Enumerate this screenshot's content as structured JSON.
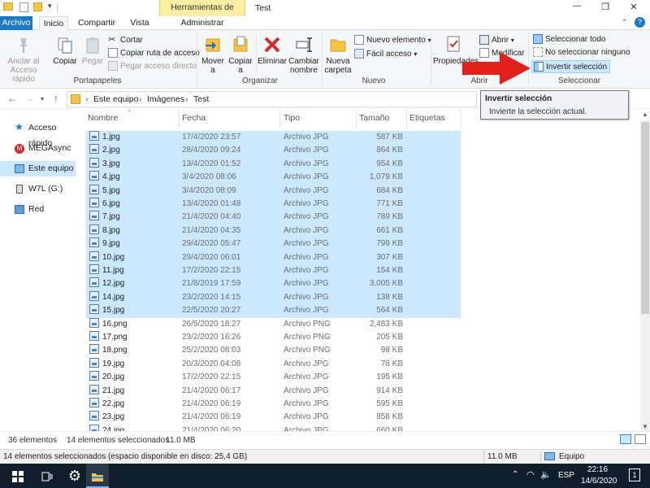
{
  "window": {
    "title": "Test",
    "contextual_tab_group": "Herramientas de imagen",
    "controls": {
      "minimize": "—",
      "maximize": "❐",
      "close": "✕"
    }
  },
  "tabs": [
    "Archivo",
    "Inicio",
    "Compartir",
    "Vista",
    "Administrar"
  ],
  "ribbon": {
    "portapapeles": {
      "label": "Portapapeles",
      "anclar": "Anclar al Acceso rápido",
      "copiar": "Copiar",
      "pegar": "Pegar",
      "cortar": "Cortar",
      "copiar_ruta": "Copiar ruta de acceso",
      "pegar_acceso": "Pegar acceso directo"
    },
    "organizar": {
      "label": "Organizar",
      "mover": "Mover a",
      "copiar": "Copiar a",
      "eliminar": "Eliminar",
      "cambiar": "Cambiar nombre"
    },
    "nuevo": {
      "label": "Nuevo",
      "carpeta": "Nueva carpeta",
      "elemento": "Nuevo elemento",
      "facil": "Fácil acceso"
    },
    "abrir": {
      "label": "Abrir",
      "propiedades": "Propiedades",
      "abrir": "Abrir",
      "modificar": "Modificar"
    },
    "seleccionar": {
      "label": "Seleccionar",
      "todo": "Seleccionar todo",
      "ninguno": "No seleccionar ninguno",
      "invertir": "Invertir selección"
    }
  },
  "tooltip": {
    "title": "Invertir selección",
    "body": "Invierte la selección actual."
  },
  "breadcrumb": [
    "Este equipo",
    "Imágenes",
    "Test"
  ],
  "nav": [
    "Acceso rápido",
    "MEGAsync",
    "Este equipo",
    "W7L (G:)",
    "Red"
  ],
  "columns": [
    "Nombre",
    "Fecha",
    "Tipo",
    "Tamaño",
    "Etiquetas"
  ],
  "files": [
    {
      "name": "1.jpg",
      "date": "17/4/2020 23:57",
      "type": "Archivo JPG",
      "size": "587 KB",
      "selected": true
    },
    {
      "name": "2.jpg",
      "date": "28/4/2020 09:24",
      "type": "Archivo JPG",
      "size": "864 KB",
      "selected": true
    },
    {
      "name": "3.jpg",
      "date": "13/4/2020 01:52",
      "type": "Archivo JPG",
      "size": "954 KB",
      "selected": true
    },
    {
      "name": "4.jpg",
      "date": "3/4/2020 08:06",
      "type": "Archivo JPG",
      "size": "1,079 KB",
      "selected": true
    },
    {
      "name": "5.jpg",
      "date": "3/4/2020 08:09",
      "type": "Archivo JPG",
      "size": "684 KB",
      "selected": true
    },
    {
      "name": "6.jpg",
      "date": "13/4/2020 01:48",
      "type": "Archivo JPG",
      "size": "771 KB",
      "selected": true
    },
    {
      "name": "7.jpg",
      "date": "21/4/2020 04:40",
      "type": "Archivo JPG",
      "size": "789 KB",
      "selected": true
    },
    {
      "name": "8.jpg",
      "date": "21/4/2020 04:35",
      "type": "Archivo JPG",
      "size": "661 KB",
      "selected": true
    },
    {
      "name": "9.jpg",
      "date": "29/4/2020 05:47",
      "type": "Archivo JPG",
      "size": "799 KB",
      "selected": true
    },
    {
      "name": "10.jpg",
      "date": "29/4/2020 06:01",
      "type": "Archivo JPG",
      "size": "307 KB",
      "selected": true
    },
    {
      "name": "11.jpg",
      "date": "17/2/2020 22:15",
      "type": "Archivo JPG",
      "size": "154 KB",
      "selected": true
    },
    {
      "name": "12.jpg",
      "date": "21/8/2019 17:59",
      "type": "Archivo JPG",
      "size": "3,005 KB",
      "selected": true
    },
    {
      "name": "14.jpg",
      "date": "23/2/2020 14:15",
      "type": "Archivo JPG",
      "size": "138 KB",
      "selected": true
    },
    {
      "name": "15.jpg",
      "date": "22/5/2020 20:27",
      "type": "Archivo JPG",
      "size": "564 KB",
      "selected": true
    },
    {
      "name": "16.png",
      "date": "26/5/2020 18:27",
      "type": "Archivo PNG",
      "size": "2,483 KB",
      "selected": false
    },
    {
      "name": "17.png",
      "date": "23/2/2020 16:26",
      "type": "Archivo PNG",
      "size": "205 KB",
      "selected": false
    },
    {
      "name": "18.png",
      "date": "25/2/2020 08:03",
      "type": "Archivo PNG",
      "size": "98 KB",
      "selected": false
    },
    {
      "name": "19.jpg",
      "date": "20/3/2020 04:08",
      "type": "Archivo JPG",
      "size": "78 KB",
      "selected": false
    },
    {
      "name": "20.jpg",
      "date": "17/2/2020 22:15",
      "type": "Archivo JPG",
      "size": "195 KB",
      "selected": false
    },
    {
      "name": "21.jpg",
      "date": "21/4/2020 06:17",
      "type": "Archivo JPG",
      "size": "914 KB",
      "selected": false
    },
    {
      "name": "22.jpg",
      "date": "21/4/2020 06:19",
      "type": "Archivo JPG",
      "size": "595 KB",
      "selected": false
    },
    {
      "name": "23.jpg",
      "date": "21/4/2020 06:19",
      "type": "Archivo JPG",
      "size": "858 KB",
      "selected": false
    },
    {
      "name": "24.jpg",
      "date": "21/4/2020 06:20",
      "type": "Archivo JPG",
      "size": "660 KB",
      "selected": false
    }
  ],
  "status": {
    "count": "36 elementos",
    "selected": "14 elementos seleccionados",
    "selected_size": "11.0 MB"
  },
  "details": {
    "text": "14 elementos seleccionados (espacio disponible en disco: 25,4 GB)",
    "size": "11.0 MB",
    "location": "Equipo"
  },
  "taskbar": {
    "lang": "ESP",
    "time": "22:16",
    "date": "14/6/2020",
    "notifications": "1"
  },
  "colors": {
    "selection": "#cce8ff",
    "tooltip_bg": "#f1f2f7",
    "archivo_tab": "#1979ca",
    "contextual": "#fbeda2",
    "taskbar": "#101d2a",
    "arrow": "#e32019"
  }
}
